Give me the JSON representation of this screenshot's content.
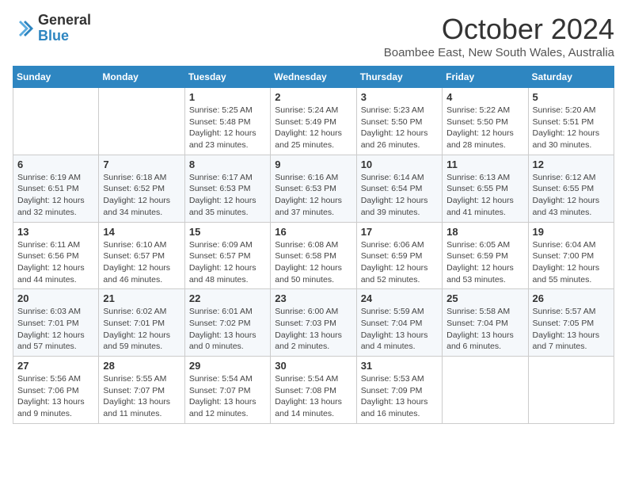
{
  "header": {
    "logo_general": "General",
    "logo_blue": "Blue",
    "month_title": "October 2024",
    "subtitle": "Boambee East, New South Wales, Australia"
  },
  "weekdays": [
    "Sunday",
    "Monday",
    "Tuesday",
    "Wednesday",
    "Thursday",
    "Friday",
    "Saturday"
  ],
  "weeks": [
    [
      {
        "day": "",
        "info": ""
      },
      {
        "day": "",
        "info": ""
      },
      {
        "day": "1",
        "info": "Sunrise: 5:25 AM\nSunset: 5:48 PM\nDaylight: 12 hours and 23 minutes."
      },
      {
        "day": "2",
        "info": "Sunrise: 5:24 AM\nSunset: 5:49 PM\nDaylight: 12 hours and 25 minutes."
      },
      {
        "day": "3",
        "info": "Sunrise: 5:23 AM\nSunset: 5:50 PM\nDaylight: 12 hours and 26 minutes."
      },
      {
        "day": "4",
        "info": "Sunrise: 5:22 AM\nSunset: 5:50 PM\nDaylight: 12 hours and 28 minutes."
      },
      {
        "day": "5",
        "info": "Sunrise: 5:20 AM\nSunset: 5:51 PM\nDaylight: 12 hours and 30 minutes."
      }
    ],
    [
      {
        "day": "6",
        "info": "Sunrise: 6:19 AM\nSunset: 6:51 PM\nDaylight: 12 hours and 32 minutes."
      },
      {
        "day": "7",
        "info": "Sunrise: 6:18 AM\nSunset: 6:52 PM\nDaylight: 12 hours and 34 minutes."
      },
      {
        "day": "8",
        "info": "Sunrise: 6:17 AM\nSunset: 6:53 PM\nDaylight: 12 hours and 35 minutes."
      },
      {
        "day": "9",
        "info": "Sunrise: 6:16 AM\nSunset: 6:53 PM\nDaylight: 12 hours and 37 minutes."
      },
      {
        "day": "10",
        "info": "Sunrise: 6:14 AM\nSunset: 6:54 PM\nDaylight: 12 hours and 39 minutes."
      },
      {
        "day": "11",
        "info": "Sunrise: 6:13 AM\nSunset: 6:55 PM\nDaylight: 12 hours and 41 minutes."
      },
      {
        "day": "12",
        "info": "Sunrise: 6:12 AM\nSunset: 6:55 PM\nDaylight: 12 hours and 43 minutes."
      }
    ],
    [
      {
        "day": "13",
        "info": "Sunrise: 6:11 AM\nSunset: 6:56 PM\nDaylight: 12 hours and 44 minutes."
      },
      {
        "day": "14",
        "info": "Sunrise: 6:10 AM\nSunset: 6:57 PM\nDaylight: 12 hours and 46 minutes."
      },
      {
        "day": "15",
        "info": "Sunrise: 6:09 AM\nSunset: 6:57 PM\nDaylight: 12 hours and 48 minutes."
      },
      {
        "day": "16",
        "info": "Sunrise: 6:08 AM\nSunset: 6:58 PM\nDaylight: 12 hours and 50 minutes."
      },
      {
        "day": "17",
        "info": "Sunrise: 6:06 AM\nSunset: 6:59 PM\nDaylight: 12 hours and 52 minutes."
      },
      {
        "day": "18",
        "info": "Sunrise: 6:05 AM\nSunset: 6:59 PM\nDaylight: 12 hours and 53 minutes."
      },
      {
        "day": "19",
        "info": "Sunrise: 6:04 AM\nSunset: 7:00 PM\nDaylight: 12 hours and 55 minutes."
      }
    ],
    [
      {
        "day": "20",
        "info": "Sunrise: 6:03 AM\nSunset: 7:01 PM\nDaylight: 12 hours and 57 minutes."
      },
      {
        "day": "21",
        "info": "Sunrise: 6:02 AM\nSunset: 7:01 PM\nDaylight: 12 hours and 59 minutes."
      },
      {
        "day": "22",
        "info": "Sunrise: 6:01 AM\nSunset: 7:02 PM\nDaylight: 13 hours and 0 minutes."
      },
      {
        "day": "23",
        "info": "Sunrise: 6:00 AM\nSunset: 7:03 PM\nDaylight: 13 hours and 2 minutes."
      },
      {
        "day": "24",
        "info": "Sunrise: 5:59 AM\nSunset: 7:04 PM\nDaylight: 13 hours and 4 minutes."
      },
      {
        "day": "25",
        "info": "Sunrise: 5:58 AM\nSunset: 7:04 PM\nDaylight: 13 hours and 6 minutes."
      },
      {
        "day": "26",
        "info": "Sunrise: 5:57 AM\nSunset: 7:05 PM\nDaylight: 13 hours and 7 minutes."
      }
    ],
    [
      {
        "day": "27",
        "info": "Sunrise: 5:56 AM\nSunset: 7:06 PM\nDaylight: 13 hours and 9 minutes."
      },
      {
        "day": "28",
        "info": "Sunrise: 5:55 AM\nSunset: 7:07 PM\nDaylight: 13 hours and 11 minutes."
      },
      {
        "day": "29",
        "info": "Sunrise: 5:54 AM\nSunset: 7:07 PM\nDaylight: 13 hours and 12 minutes."
      },
      {
        "day": "30",
        "info": "Sunrise: 5:54 AM\nSunset: 7:08 PM\nDaylight: 13 hours and 14 minutes."
      },
      {
        "day": "31",
        "info": "Sunrise: 5:53 AM\nSunset: 7:09 PM\nDaylight: 13 hours and 16 minutes."
      },
      {
        "day": "",
        "info": ""
      },
      {
        "day": "",
        "info": ""
      }
    ]
  ]
}
